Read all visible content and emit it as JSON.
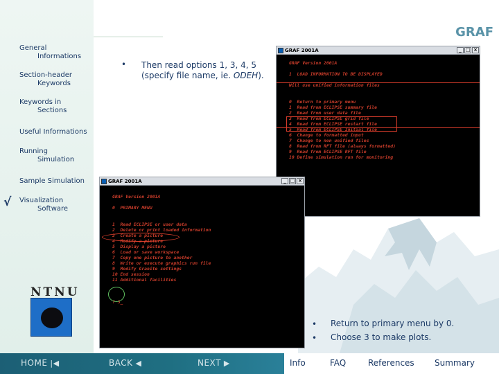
{
  "header": {
    "title": "GRAF"
  },
  "sidebar": {
    "items": [
      {
        "line1": "General",
        "line2": "Informations"
      },
      {
        "line1": "Section-header",
        "line2": "Keywords"
      },
      {
        "line1": "Keywords in",
        "line2": "Sections"
      },
      {
        "line1": "Useful Informations",
        "line2": ""
      },
      {
        "line1": "Running",
        "line2": "Simulation"
      },
      {
        "line1": "Sample Simulation",
        "line2": ""
      },
      {
        "line1": "Visualization",
        "line2": "Software"
      }
    ],
    "check_mark": "√"
  },
  "instructions": {
    "top_text_1": "Then read options 1, 3, 4, 5",
    "top_text_2_prefix": "(specify file name, ie. ",
    "top_text_2_italic": "ODEH",
    "top_text_2_suffix": ").",
    "bottom_1": "Return to primary menu by 0.",
    "bottom_2": "Choose 3 to make plots."
  },
  "window_top": {
    "title": "GRAF 2001A",
    "lines": [
      "GRAF Version 2001A",
      "",
      "1  LOAD INFORMATION TO BE DISPLAYED",
      "",
      "Will use unified information files",
      "",
      "",
      "0  Return to primary menu",
      "1  Read from ECLIPSE summary file",
      "2  Read from user data file",
      "3  Read from ECLIPSE grid file",
      "4  Read from ECLIPSE restart file",
      "5  Read from ECLIPSE Initial file",
      "6  Change to formatted input",
      "7  Change to non unified files",
      "8  Read from RFT file (always formatted)",
      "9  Read from ECLIPSE RFT file",
      "10 Define simulation run for monitoring",
      "",
      "",
      "",
      "",
      "",
      "? _"
    ]
  },
  "window_bottom": {
    "title": "GRAF 2001A",
    "lines": [
      "GRAF Version 2001A",
      "",
      "0  PRIMARY MENU",
      "",
      "",
      "1  Read ECLIPSE or user data",
      "2  Delete or print loaded information",
      "3  Create a picture",
      "4  Modify a picture",
      "5  Display a picture",
      "6  Load or save workspace",
      "7  Copy one picture to another",
      "8  Write or execute graphics run file",
      "9  Modify Granite settings",
      "10 End session",
      "11 Additional facilities",
      "",
      "",
      "",
      "? 3_"
    ]
  },
  "window_controls": {
    "minimize": "_",
    "maximize": "□",
    "close": "×"
  },
  "logo": {
    "text": "NTNU"
  },
  "footer": {
    "home": "HOME",
    "back": "BACK",
    "next": "NEXT",
    "info": "Info",
    "faq": "FAQ",
    "references": "References",
    "summary": "Summary"
  },
  "colors": {
    "accent": "#5a93a8",
    "nav_text": "#1c3a66",
    "terminal_text": "#c83c2a",
    "highlight": "#d23a2a",
    "footer_bar": "#1c5f75"
  }
}
